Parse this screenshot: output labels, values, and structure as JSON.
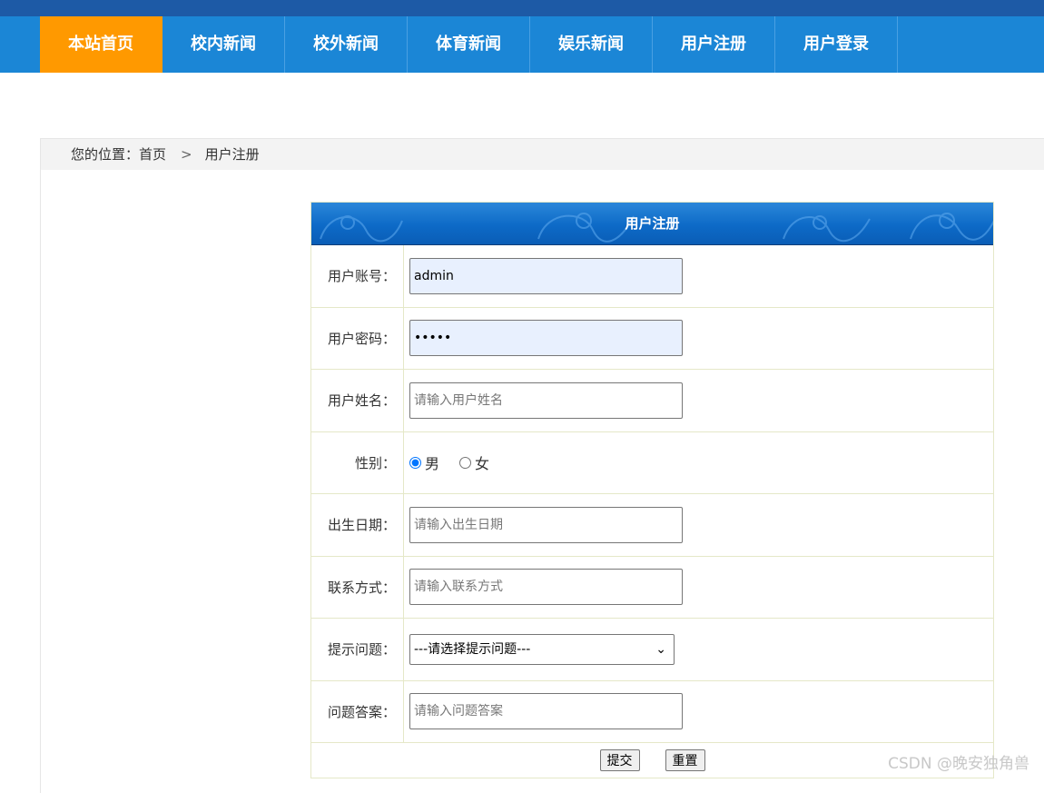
{
  "nav": {
    "items": [
      {
        "label": "本站首页",
        "active": true
      },
      {
        "label": "校内新闻"
      },
      {
        "label": "校外新闻"
      },
      {
        "label": "体育新闻"
      },
      {
        "label": "娱乐新闻"
      },
      {
        "label": "用户注册"
      },
      {
        "label": "用户登录"
      }
    ]
  },
  "breadcrumb": {
    "prefix": "您的位置：",
    "home": "首页",
    "separator": ">",
    "current": "用户注册"
  },
  "form": {
    "title": "用户注册",
    "account": {
      "label": "用户账号：",
      "value": "admin"
    },
    "password": {
      "label": "用户密码：",
      "value": "•••••"
    },
    "name": {
      "label": "用户姓名：",
      "placeholder": "请输入用户姓名"
    },
    "gender": {
      "label": "性别：",
      "options": [
        "男",
        "女"
      ],
      "selected": "男"
    },
    "birthday": {
      "label": "出生日期：",
      "placeholder": "请输入出生日期"
    },
    "contact": {
      "label": "联系方式：",
      "placeholder": "请输入联系方式"
    },
    "question": {
      "label": "提示问题：",
      "selected": "---请选择提示问题---"
    },
    "answer": {
      "label": "问题答案：",
      "placeholder": "请输入问题答案"
    },
    "submit_label": "提交",
    "reset_label": "重置"
  },
  "watermark": "CSDN @晚安独角兽",
  "colors": {
    "nav_bg": "#1b86d6",
    "nav_active": "#ff9900",
    "top_strip": "#1d5aa6",
    "form_header": "#0d6ac7"
  }
}
